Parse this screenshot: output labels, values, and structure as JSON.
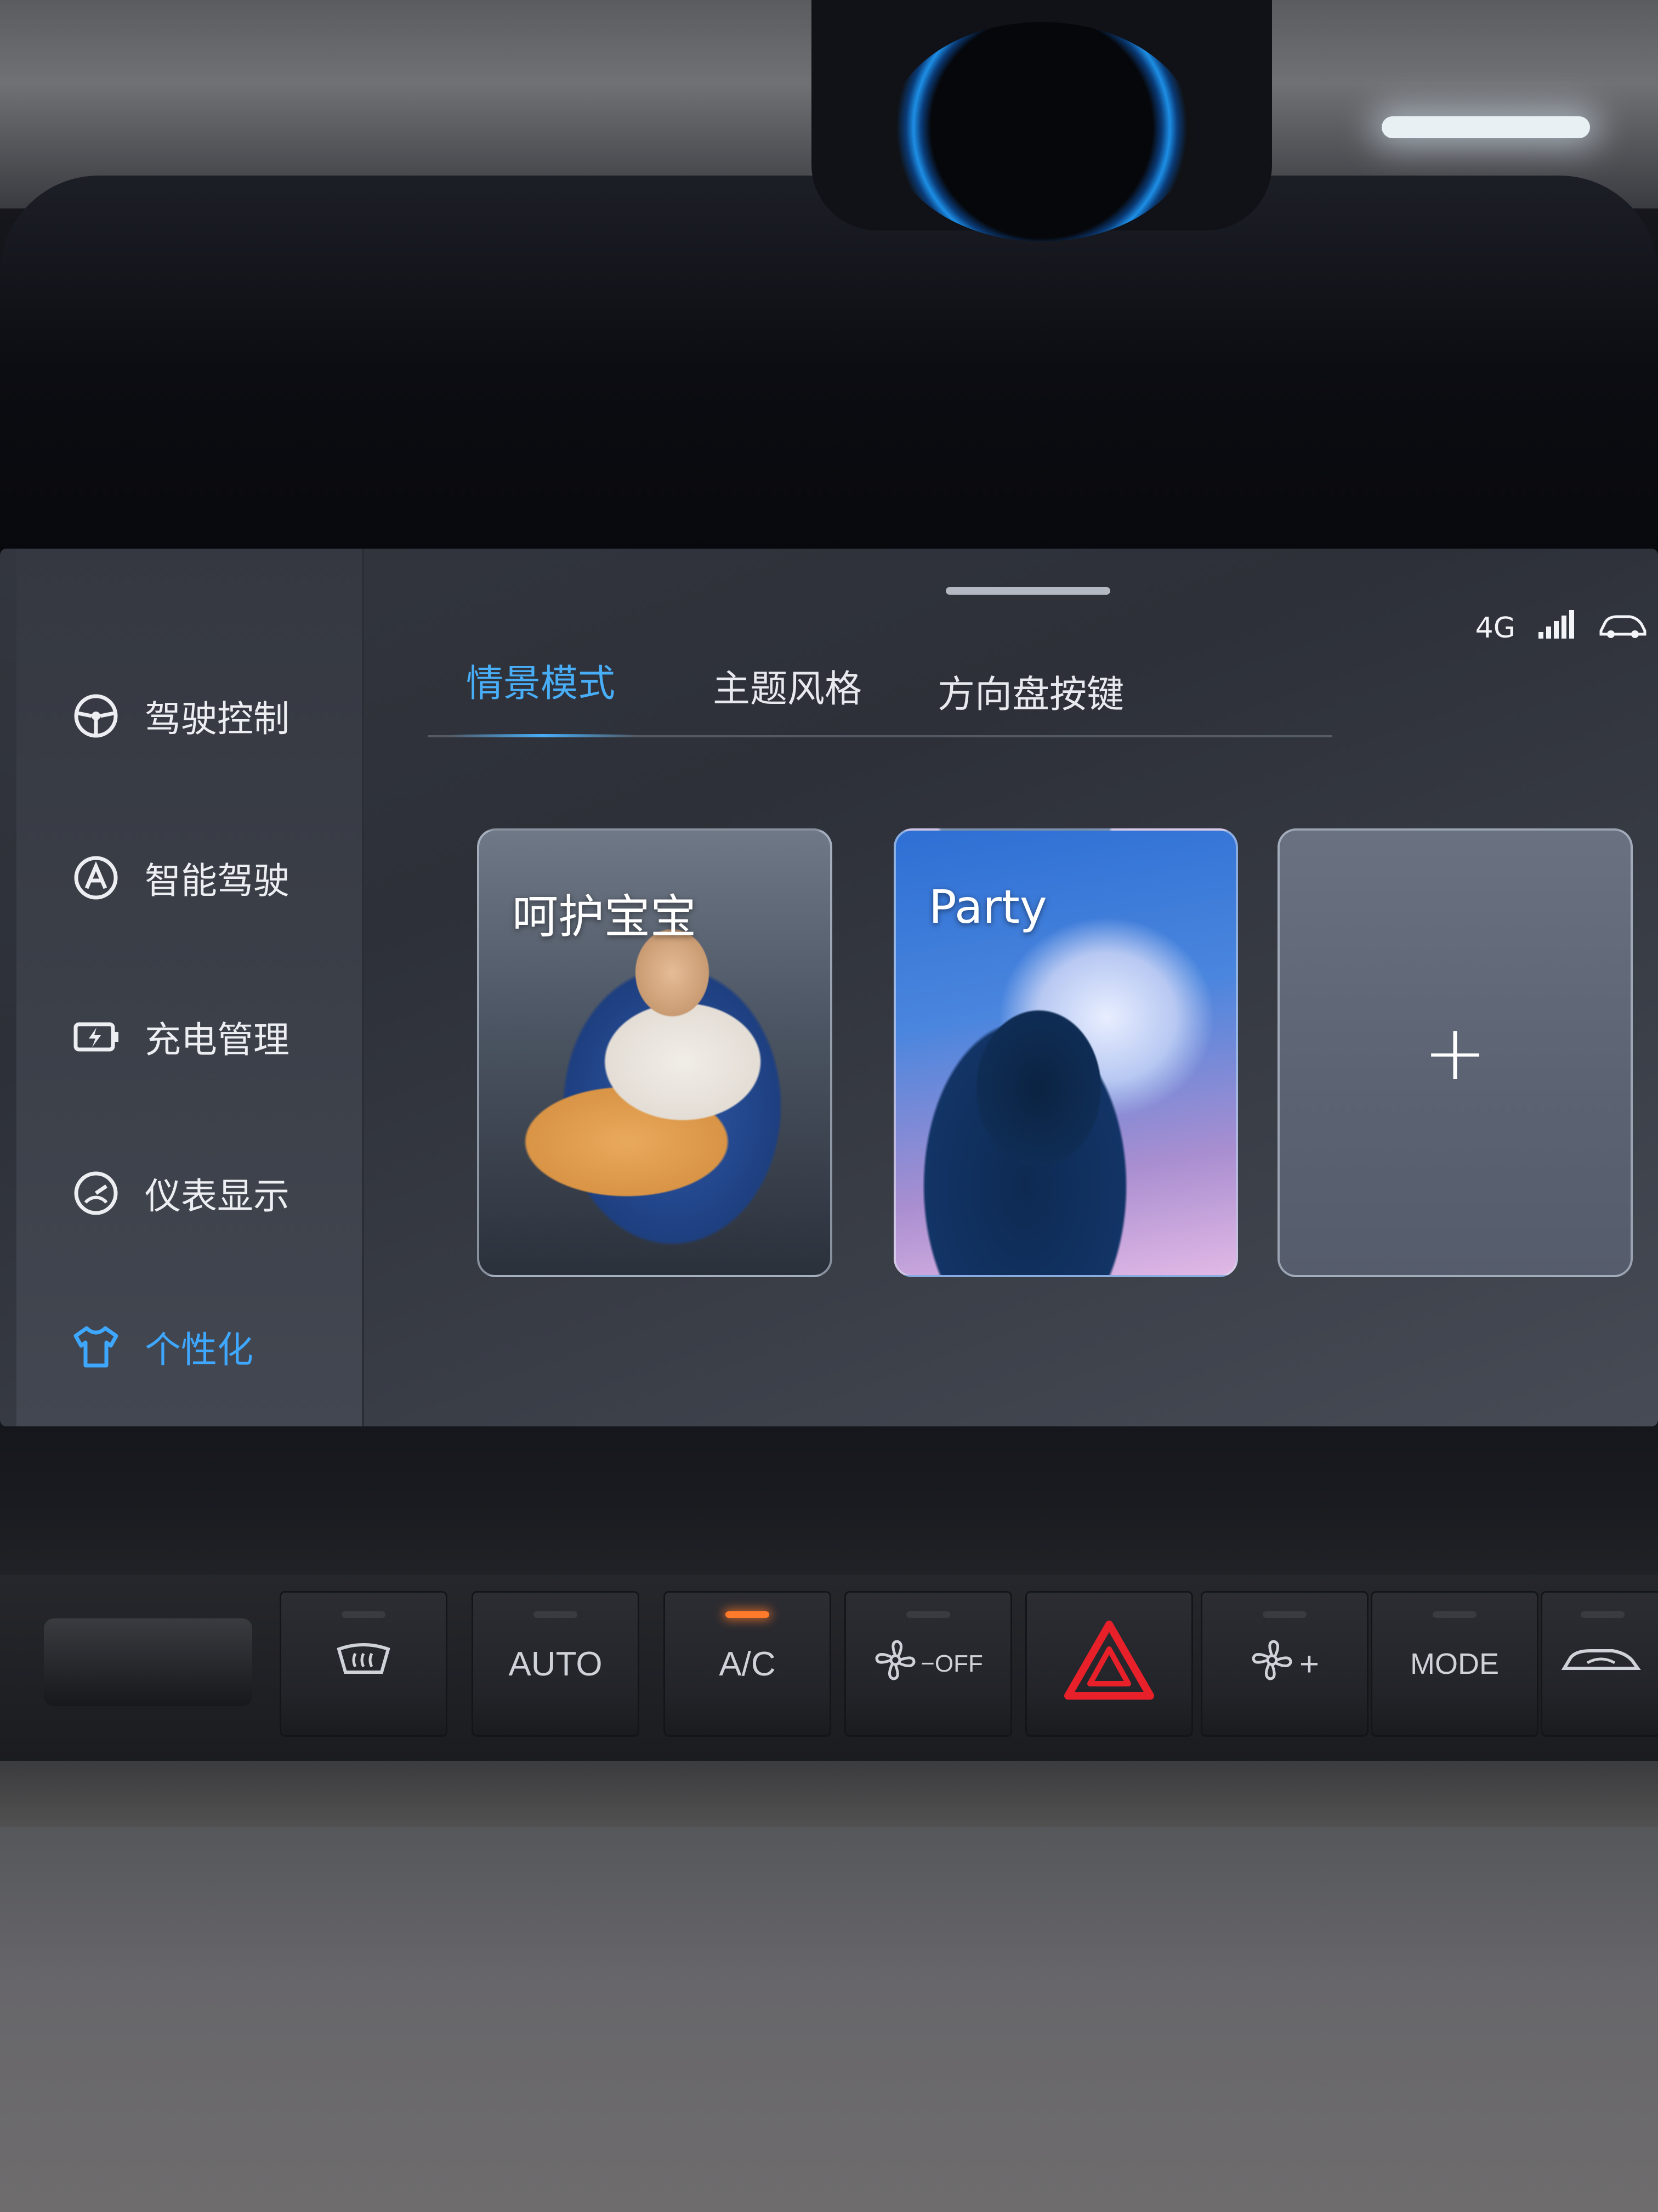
{
  "status": {
    "network": "4G"
  },
  "sidebar": {
    "items": [
      {
        "label": "驾驶控制",
        "icon": "steering-wheel-icon",
        "active": false
      },
      {
        "label": "智能驾驶",
        "icon": "autopilot-icon",
        "active": false
      },
      {
        "label": "充电管理",
        "icon": "battery-icon",
        "active": false
      },
      {
        "label": "仪表显示",
        "icon": "gauge-icon",
        "active": false
      },
      {
        "label": "个性化",
        "icon": "shirt-icon",
        "active": true
      }
    ]
  },
  "tabs": [
    {
      "label": "情景模式",
      "active": true
    },
    {
      "label": "主题风格",
      "active": false
    },
    {
      "label": "方向盘按键",
      "active": false
    }
  ],
  "scenes": [
    {
      "title": "呵护宝宝"
    },
    {
      "title": "Party"
    },
    {
      "title": "+"
    }
  ],
  "climate": {
    "buttons": [
      {
        "name": "defrost-button",
        "label": "",
        "icon": "rear-defrost-icon"
      },
      {
        "name": "auto-button",
        "label": "AUTO"
      },
      {
        "name": "ac-button",
        "label": "A/C",
        "led_on": true
      },
      {
        "name": "fan-off-button",
        "label": "−OFF",
        "icon": "fan-icon"
      },
      {
        "name": "hazard-button",
        "label": "",
        "icon": "hazard-icon"
      },
      {
        "name": "fan-plus-button",
        "label": "+",
        "icon": "fan-icon"
      },
      {
        "name": "mode-button",
        "label": "MODE"
      },
      {
        "name": "recirculation-button",
        "label": "",
        "icon": "car-recirculation-icon"
      }
    ]
  },
  "colors": {
    "accent": "#48aef8",
    "hazard": "#e8202a",
    "ac_led": "#ff7a2b"
  }
}
